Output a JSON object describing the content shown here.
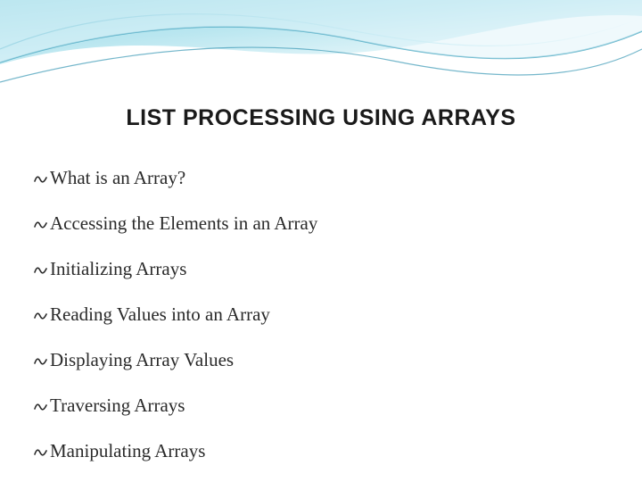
{
  "title": "LIST PROCESSING USING ARRAYS",
  "bullets": {
    "0": "What is an Array?",
    "1": "Accessing the Elements in an Array",
    "2": "Initializing Arrays",
    "3": "Reading Values into an Array",
    "4": "Displaying Array Values",
    "5": "Traversing Arrays",
    "6": "Manipulating Arrays"
  }
}
